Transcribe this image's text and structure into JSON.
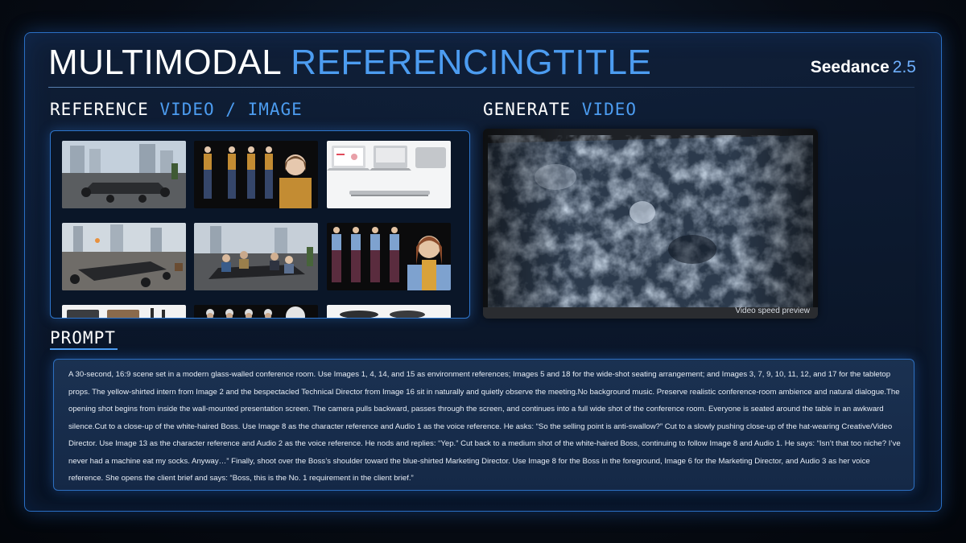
{
  "title": {
    "main": "MULTIMODAL ",
    "accent": "REFERENCINGTITLE"
  },
  "brand": {
    "name": "Seedance",
    "version": "2.5"
  },
  "reference": {
    "label_a": "REFERENCE ",
    "label_b": "VIDEO / IMAGE"
  },
  "generate": {
    "label_a": "GENERATE ",
    "label_b": "VIDEO",
    "note": "Video speed preview"
  },
  "prompt": {
    "label": "PROMPT",
    "text": "A 30-second, 16:9 scene set in a modern glass-walled conference room. Use Images 1, 4, 14, and 15 as environment references; Images 5 and 18 for the wide-shot seating arrangement; and Images 3, 7, 9, 10, 11, 12, and 17 for the tabletop props. The yellow-shirted intern from Image 2 and the bespectacled Technical Director from Image 16 sit in naturally and quietly observe the meeting.No background music. Preserve realistic conference-room ambience and natural dialogue.The opening shot begins from inside the wall-mounted presentation screen. The camera pulls backward, passes through the screen, and continues into a full wide shot of the conference room. Everyone is seated around the table in an awkward silence.Cut to a close-up of the white-haired Boss. Use Image 8 as the character reference and Audio 1 as the voice reference. He asks: “So the selling point is anti-swallow?” Cut to a slowly pushing close-up of the hat-wearing Creative/Video Director. Use Image 13 as the character reference and Audio 2 as the voice reference. He nods and replies: “Yep.” Cut back to a medium shot of the white-haired Boss, continuing to follow Image 8 and Audio 1. He says: “Isn’t that too niche? I’ve never had a machine eat my socks. Anyway…” Finally, shoot over the Boss’s shoulder toward the blue-shirted Marketing Director. Use Image 8 for the Boss in the foreground, Image 6 for the Marketing Director, and Audio 3 as her voice reference. She opens the client brief and says: “Boss, this is the No. 1 requirement in the client brief.”"
  },
  "colors": {
    "accent": "#4c9cf0",
    "frame": "#2a6fc4",
    "background": "#070c15"
  }
}
